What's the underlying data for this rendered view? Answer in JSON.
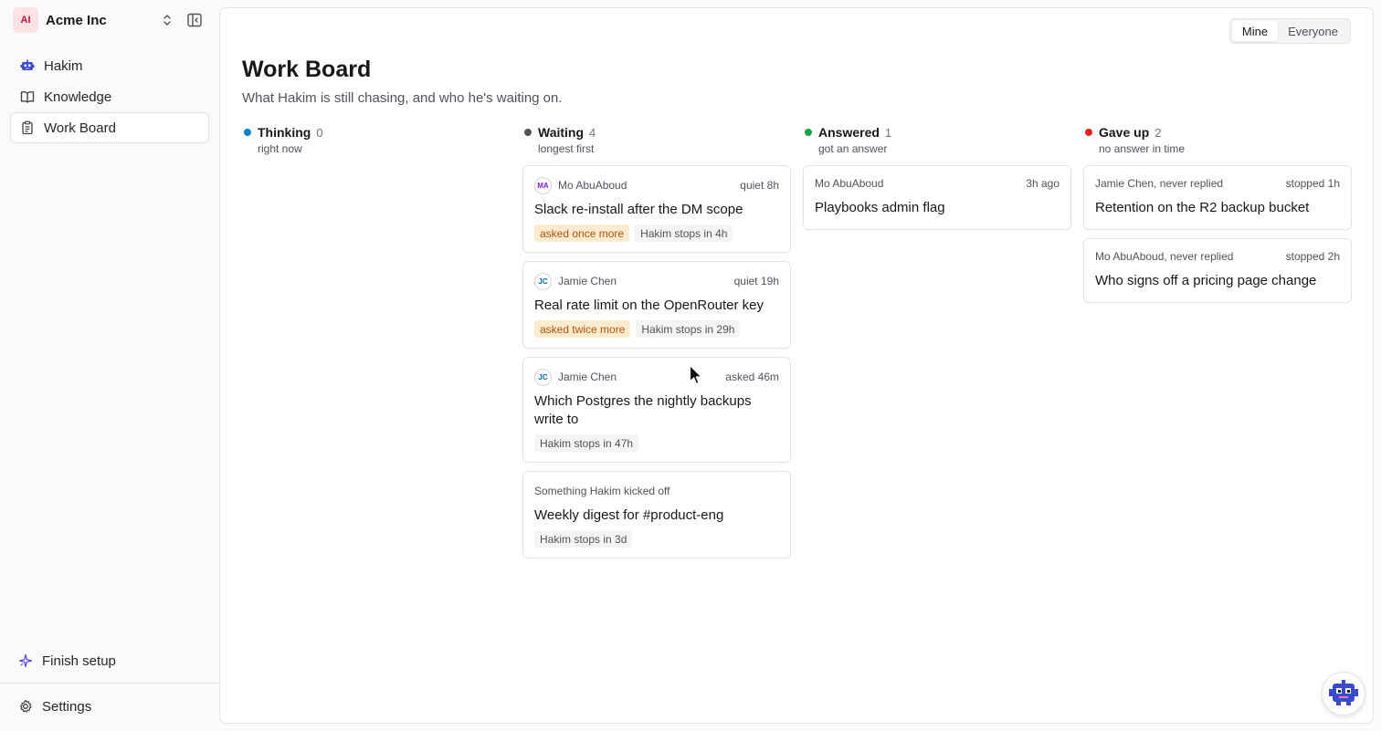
{
  "workspace": {
    "initials": "AI",
    "name": "Acme Inc"
  },
  "sidebar": {
    "items": [
      {
        "label": "Hakim",
        "icon": "robot-icon"
      },
      {
        "label": "Knowledge",
        "icon": "book-icon"
      },
      {
        "label": "Work Board",
        "icon": "clipboard-icon",
        "active": true
      }
    ],
    "finish_setup": "Finish setup",
    "settings": "Settings"
  },
  "toggle": {
    "mine": "Mine",
    "everyone": "Everyone",
    "selected": "Mine"
  },
  "page": {
    "title": "Work Board",
    "subtitle": "What Hakim is still chasing, and who he's waiting on."
  },
  "columns": [
    {
      "name": "Thinking",
      "count": "0",
      "hint": "right now",
      "color": "#0284c7",
      "cards": []
    },
    {
      "name": "Waiting",
      "count": "4",
      "hint": "longest first",
      "color": "#52525b",
      "cards": [
        {
          "initials": "MA",
          "avatar_color": "#7e22ce",
          "who": "Mo AbuAboud",
          "when": "quiet 8h",
          "title": "Slack re-install after the DM scope",
          "chips": [
            {
              "text": "asked once more",
              "warn": true
            },
            {
              "text": "Hakim stops in 4h",
              "warn": false
            }
          ]
        },
        {
          "initials": "JC",
          "avatar_color": "#0369a1",
          "who": "Jamie Chen",
          "when": "quiet 19h",
          "title": "Real rate limit on the OpenRouter key",
          "chips": [
            {
              "text": "asked twice more",
              "warn": true
            },
            {
              "text": "Hakim stops in 29h",
              "warn": false
            }
          ]
        },
        {
          "initials": "JC",
          "avatar_color": "#0369a1",
          "who": "Jamie Chen",
          "when": "asked 46m",
          "title": "Which Postgres the nightly backups write to",
          "chips": [
            {
              "text": "Hakim stops in 47h",
              "warn": false
            }
          ]
        },
        {
          "initials": "",
          "who": "Something Hakim kicked off",
          "when": "",
          "title": "Weekly digest for #product-eng",
          "chips": [
            {
              "text": "Hakim stops in 3d",
              "warn": false
            }
          ]
        }
      ]
    },
    {
      "name": "Answered",
      "count": "1",
      "hint": "got an answer",
      "color": "#16a34a",
      "cards": [
        {
          "initials": "",
          "who": "Mo AbuAboud",
          "when": "3h ago",
          "title": "Playbooks admin flag",
          "chips": []
        }
      ]
    },
    {
      "name": "Gave up",
      "count": "2",
      "hint": "no answer in time",
      "color": "#dc2626",
      "cards": [
        {
          "initials": "",
          "who": "Jamie Chen, never replied",
          "when": "stopped 1h",
          "title": "Retention on the R2 backup bucket",
          "chips": []
        },
        {
          "initials": "",
          "who": "Mo AbuAboud, never replied",
          "when": "stopped 2h",
          "title": "Who signs off a pricing page change",
          "chips": []
        }
      ]
    }
  ]
}
